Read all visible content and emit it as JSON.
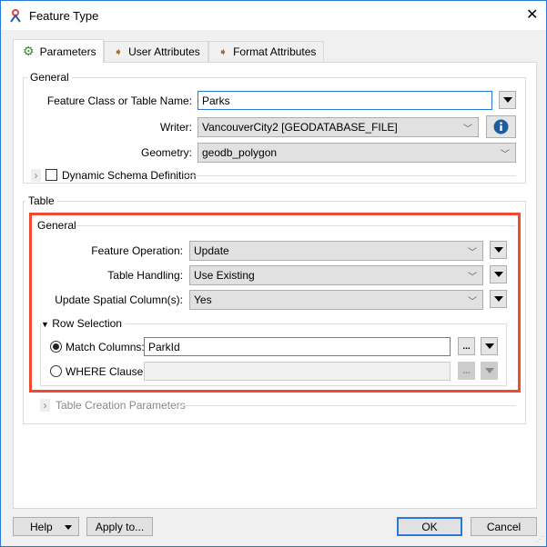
{
  "window": {
    "title": "Feature Type"
  },
  "tabs": [
    {
      "label": "Parameters",
      "icon": "gear-icon"
    },
    {
      "label": "User Attributes",
      "icon": "arrow-tag-icon"
    },
    {
      "label": "Format Attributes",
      "icon": "arrow-tag-icon"
    }
  ],
  "general": {
    "legend": "General",
    "feature_class_label": "Feature Class or Table Name:",
    "feature_class_value": "Parks",
    "writer_label": "Writer:",
    "writer_value": "VancouverCity2 [GEODATABASE_FILE]",
    "geometry_label": "Geometry:",
    "geometry_value": "geodb_polygon",
    "dynamic_schema_label": "Dynamic Schema Definition",
    "dynamic_schema_checked": false
  },
  "table": {
    "legend": "Table",
    "general_legend": "General",
    "feature_operation_label": "Feature Operation:",
    "feature_operation_value": "Update",
    "table_handling_label": "Table Handling:",
    "table_handling_value": "Use Existing",
    "update_spatial_label": "Update Spatial Column(s):",
    "update_spatial_value": "Yes",
    "row_selection": {
      "legend": "Row Selection",
      "match_columns_label": "Match Columns:",
      "match_columns_value": "ParkId",
      "where_clause_label": "WHERE Clause:",
      "where_clause_value": "",
      "selected": "match_columns",
      "ellipsis": "..."
    },
    "table_creation_label": "Table Creation Parameters"
  },
  "footer": {
    "help": "Help",
    "apply": "Apply to...",
    "ok": "OK",
    "cancel": "Cancel"
  },
  "colors": {
    "highlight": "#f04a2f",
    "accent": "#2b79d6"
  }
}
